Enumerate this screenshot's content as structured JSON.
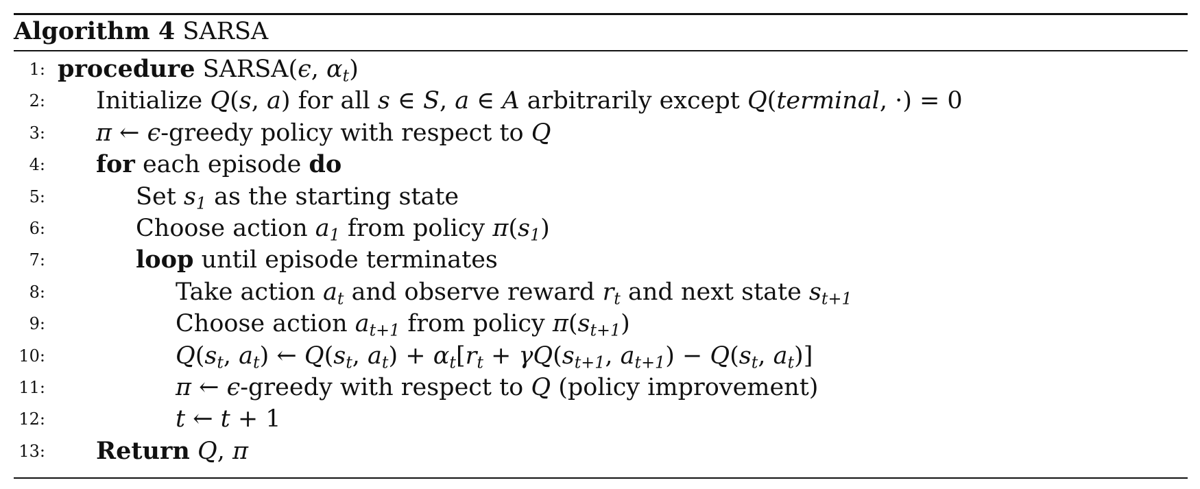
{
  "caption": {
    "label": "Algorithm 4",
    "title": "SARSA"
  },
  "lines": [
    {
      "num": "1:",
      "indent": 0,
      "parts": [
        [
          "k",
          "procedure"
        ],
        [
          "t",
          " SARSA("
        ],
        [
          "m",
          "ϵ"
        ],
        [
          "t",
          ", "
        ],
        [
          "m",
          "α"
        ],
        [
          "sub",
          "t"
        ],
        [
          "t",
          ")"
        ]
      ]
    },
    {
      "num": "2:",
      "indent": 1,
      "parts": [
        [
          "t",
          "Initialize "
        ],
        [
          "m",
          "Q"
        ],
        [
          "t",
          "("
        ],
        [
          "m",
          "s"
        ],
        [
          "t",
          ", "
        ],
        [
          "m",
          "a"
        ],
        [
          "t",
          ") for all "
        ],
        [
          "m",
          "s"
        ],
        [
          "t",
          " ∈ "
        ],
        [
          "m",
          "S"
        ],
        [
          "t",
          ", "
        ],
        [
          "m",
          "a"
        ],
        [
          "t",
          " ∈ "
        ],
        [
          "m",
          "A"
        ],
        [
          "t",
          " arbitrarily except "
        ],
        [
          "m",
          "Q"
        ],
        [
          "t",
          "("
        ],
        [
          "m",
          "terminal"
        ],
        [
          "t",
          ", ·) = 0"
        ]
      ]
    },
    {
      "num": "3:",
      "indent": 1,
      "parts": [
        [
          "m",
          "π"
        ],
        [
          "t",
          " ← "
        ],
        [
          "m",
          "ϵ"
        ],
        [
          "t",
          "-greedy policy with respect to "
        ],
        [
          "m",
          "Q"
        ]
      ]
    },
    {
      "num": "4:",
      "indent": 1,
      "parts": [
        [
          "k",
          "for"
        ],
        [
          "t",
          " each episode "
        ],
        [
          "k",
          "do"
        ]
      ]
    },
    {
      "num": "5:",
      "indent": 2,
      "parts": [
        [
          "t",
          "Set "
        ],
        [
          "m",
          "s"
        ],
        [
          "sub",
          "1"
        ],
        [
          "t",
          " as the starting state"
        ]
      ]
    },
    {
      "num": "6:",
      "indent": 2,
      "parts": [
        [
          "t",
          "Choose action "
        ],
        [
          "m",
          "a"
        ],
        [
          "sub",
          "1"
        ],
        [
          "t",
          " from policy "
        ],
        [
          "m",
          "π"
        ],
        [
          "t",
          "("
        ],
        [
          "m",
          "s"
        ],
        [
          "sub",
          "1"
        ],
        [
          "t",
          ")"
        ]
      ]
    },
    {
      "num": "7:",
      "indent": 2,
      "parts": [
        [
          "k",
          "loop"
        ],
        [
          "t",
          " until episode terminates"
        ]
      ]
    },
    {
      "num": "8:",
      "indent": 3,
      "parts": [
        [
          "t",
          "Take action "
        ],
        [
          "m",
          "a"
        ],
        [
          "sub",
          "t"
        ],
        [
          "t",
          " and observe reward "
        ],
        [
          "m",
          "r"
        ],
        [
          "sub",
          "t"
        ],
        [
          "t",
          " and next state "
        ],
        [
          "m",
          "s"
        ],
        [
          "sub",
          "t+1"
        ]
      ]
    },
    {
      "num": "9:",
      "indent": 3,
      "parts": [
        [
          "t",
          "Choose action "
        ],
        [
          "m",
          "a"
        ],
        [
          "sub",
          "t+1"
        ],
        [
          "t",
          " from policy "
        ],
        [
          "m",
          "π"
        ],
        [
          "t",
          "("
        ],
        [
          "m",
          "s"
        ],
        [
          "sub",
          "t+1"
        ],
        [
          "t",
          ")"
        ]
      ]
    },
    {
      "num": "10:",
      "indent": 3,
      "parts": [
        [
          "m",
          "Q"
        ],
        [
          "t",
          "("
        ],
        [
          "m",
          "s"
        ],
        [
          "sub",
          "t"
        ],
        [
          "t",
          ", "
        ],
        [
          "m",
          "a"
        ],
        [
          "sub",
          "t"
        ],
        [
          "t",
          ") ← "
        ],
        [
          "m",
          "Q"
        ],
        [
          "t",
          "("
        ],
        [
          "m",
          "s"
        ],
        [
          "sub",
          "t"
        ],
        [
          "t",
          ", "
        ],
        [
          "m",
          "a"
        ],
        [
          "sub",
          "t"
        ],
        [
          "t",
          ") + "
        ],
        [
          "m",
          "α"
        ],
        [
          "sub",
          "t"
        ],
        [
          "t",
          "["
        ],
        [
          "m",
          "r"
        ],
        [
          "sub",
          "t"
        ],
        [
          "t",
          " + "
        ],
        [
          "m",
          "γQ"
        ],
        [
          "t",
          "("
        ],
        [
          "m",
          "s"
        ],
        [
          "sub",
          "t+1"
        ],
        [
          "t",
          ", "
        ],
        [
          "m",
          "a"
        ],
        [
          "sub",
          "t+1"
        ],
        [
          "t",
          ") − "
        ],
        [
          "m",
          "Q"
        ],
        [
          "t",
          "("
        ],
        [
          "m",
          "s"
        ],
        [
          "sub",
          "t"
        ],
        [
          "t",
          ", "
        ],
        [
          "m",
          "a"
        ],
        [
          "sub",
          "t"
        ],
        [
          "t",
          ")]"
        ]
      ]
    },
    {
      "num": "11:",
      "indent": 3,
      "parts": [
        [
          "m",
          "π"
        ],
        [
          "t",
          " ← "
        ],
        [
          "m",
          "ϵ"
        ],
        [
          "t",
          "-greedy with respect to "
        ],
        [
          "m",
          "Q"
        ],
        [
          "t",
          " (policy improvement)"
        ]
      ]
    },
    {
      "num": "12:",
      "indent": 3,
      "parts": [
        [
          "m",
          "t"
        ],
        [
          "t",
          " ← "
        ],
        [
          "m",
          "t"
        ],
        [
          "t",
          " + 1"
        ]
      ]
    },
    {
      "num": "13:",
      "indent": 1,
      "parts": [
        [
          "k",
          "Return"
        ],
        [
          "t",
          " "
        ],
        [
          "m",
          "Q"
        ],
        [
          "t",
          ", "
        ],
        [
          "m",
          "π"
        ]
      ]
    }
  ]
}
